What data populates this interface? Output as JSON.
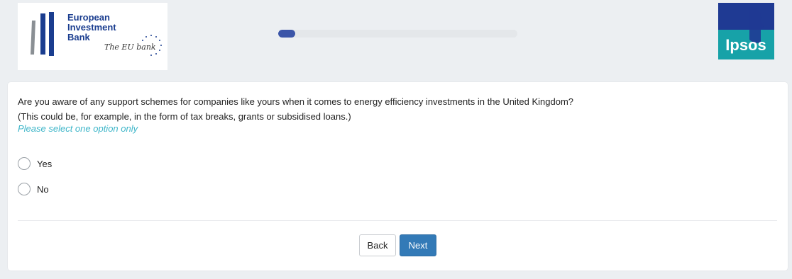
{
  "header": {
    "eib_logo": {
      "lines": [
        "European",
        "Investment",
        "Bank"
      ],
      "tagline": "The EU bank",
      "colors": {
        "text": "#1a3d8f",
        "bar_dark": "#1a3d8f",
        "bar_grey": "#8a8f94"
      }
    },
    "progress": {
      "fraction": 0.07,
      "color": "#3b55a8"
    },
    "ipsos_logo": {
      "text": "Ipsos",
      "colors": {
        "top": "#1f3a93",
        "bottom": "#17a2a8"
      }
    }
  },
  "question": {
    "text_line1": "Are you aware of any support schemes for companies like yours when it comes to energy efficiency investments in the United Kingdom?",
    "text_line2": "(This could be, for example, in the form of tax breaks, grants or subsidised loans.)",
    "hint": "Please select one option only",
    "options": [
      {
        "label": "Yes",
        "selected": false
      },
      {
        "label": "No",
        "selected": false
      }
    ]
  },
  "buttons": {
    "back_label": "Back",
    "next_label": "Next"
  }
}
